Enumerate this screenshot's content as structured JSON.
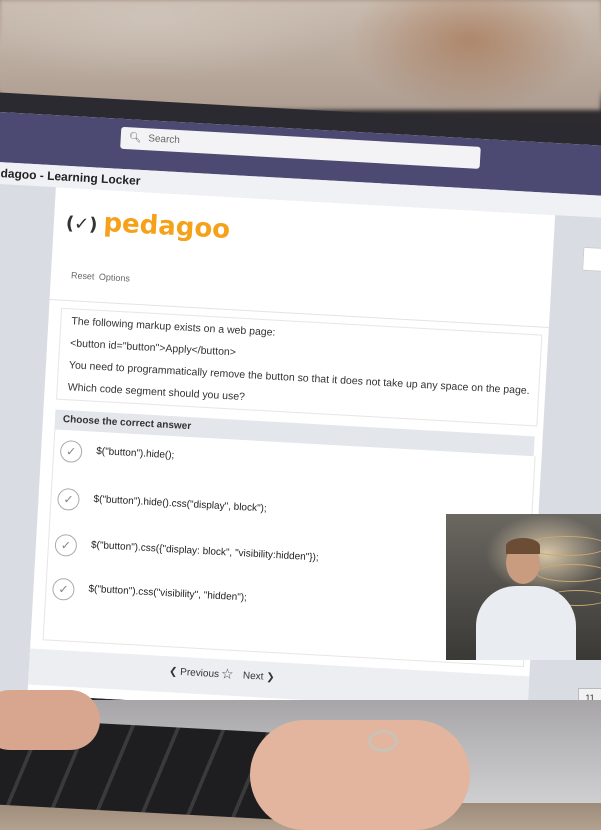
{
  "window": {
    "search_placeholder": "Search",
    "app_title": "dagoo - Learning Locker"
  },
  "brand": {
    "logo_mark": "(✓)",
    "logo_text": "pedagoo",
    "accent_color": "#f5a21a"
  },
  "toolbar": {
    "reset_label": "Reset",
    "options_label": "Options"
  },
  "question": {
    "lines": [
      "The following markup exists on a web page:",
      "<button id=\"button\">Apply</button>",
      "You need to programmatically remove the button so that it does not take up any space on the page.",
      "Which code segment should you use?"
    ]
  },
  "answers": {
    "header": "Choose the correct answer",
    "options": [
      "$(\"button\").hide();",
      "$(\"button\").hide().css(\"display\", block\");",
      "$(\"button\").css({\"display: block\", \"visibility:hidden\"});",
      "$(\"button\").css(\"visibility\", \"hidden\");"
    ]
  },
  "navigation": {
    "previous_label": "Previous",
    "next_label": "Next"
  },
  "page_number": "11"
}
